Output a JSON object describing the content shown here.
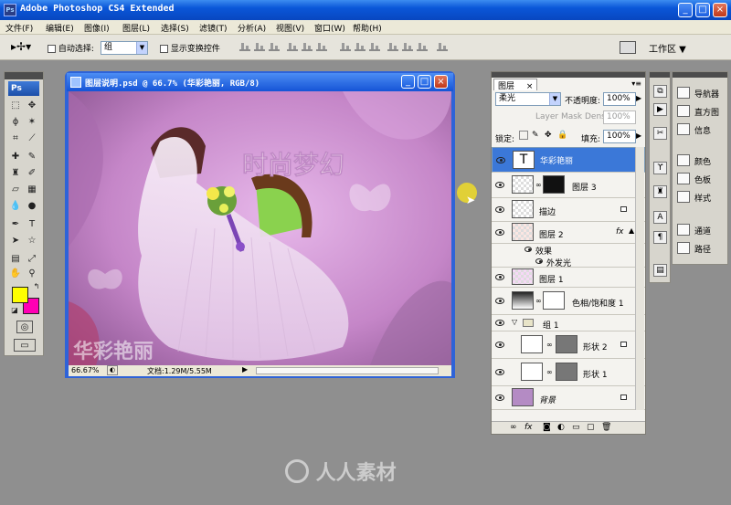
{
  "app": {
    "title": "Adobe Photoshop CS4 Extended"
  },
  "menu": [
    "文件(F)",
    "编辑(E)",
    "图像(I)",
    "图层(L)",
    "选择(S)",
    "滤镜(T)",
    "分析(A)",
    "视图(V)",
    "窗口(W)",
    "帮助(H)"
  ],
  "options": {
    "auto_select_label": "自动选择:",
    "auto_select_value": "组",
    "show_transform_label": "显示变换控件",
    "workspace_label": "工作区 ▼"
  },
  "tools": {
    "logo": "Ps"
  },
  "document": {
    "title": "图层说明.psd @ 66.7% (华彩艳丽, RGB/8)",
    "canvas_title": "时尚梦幻",
    "canvas_signature": "华彩艳丽",
    "zoom": "66.67%",
    "doc_info": "文档:1.29M/5.55M"
  },
  "layers_panel": {
    "tab": "图层",
    "blend_mode": "柔光",
    "opacity_label": "不透明度:",
    "opacity_value": "100%",
    "mask_density": "Layer Mask Density",
    "mask_density_value": "100%",
    "lock_label": "锁定:",
    "fill_label": "填充:",
    "fill_value": "100%",
    "fx": "fx",
    "layers": [
      {
        "name": "华彩艳丽",
        "type": "text",
        "selected": true
      },
      {
        "name": "图层 3",
        "type": "masked"
      },
      {
        "name": "描边",
        "type": "normal",
        "locked": true
      },
      {
        "name": "图层 2",
        "type": "fx"
      },
      {
        "name": "效果",
        "type": "effect-header"
      },
      {
        "name": "外发光",
        "type": "effect"
      },
      {
        "name": "图层 1",
        "type": "normal"
      },
      {
        "name": "色相/饱和度 1",
        "type": "adjustment"
      },
      {
        "name": "组 1",
        "type": "group"
      },
      {
        "name": "形状 2",
        "type": "shape",
        "locked": true
      },
      {
        "name": "形状 1",
        "type": "shape"
      },
      {
        "name": "背景",
        "type": "background",
        "locked": true
      }
    ]
  },
  "dock_panels": [
    {
      "label": "导航器",
      "icon": "navigator-icon"
    },
    {
      "label": "直方图",
      "icon": "histogram-icon"
    },
    {
      "label": "信息",
      "icon": "info-icon"
    },
    {
      "label": "颜色",
      "icon": "color-icon"
    },
    {
      "label": "色板",
      "icon": "swatches-icon"
    },
    {
      "label": "样式",
      "icon": "styles-icon"
    },
    {
      "label": "通道",
      "icon": "channels-icon"
    },
    {
      "label": "路径",
      "icon": "paths-icon"
    }
  ],
  "colors": {
    "foreground": "#ffff00",
    "background": "#ff00b4",
    "selection": "#3b78d8"
  },
  "watermark": "人人素材"
}
